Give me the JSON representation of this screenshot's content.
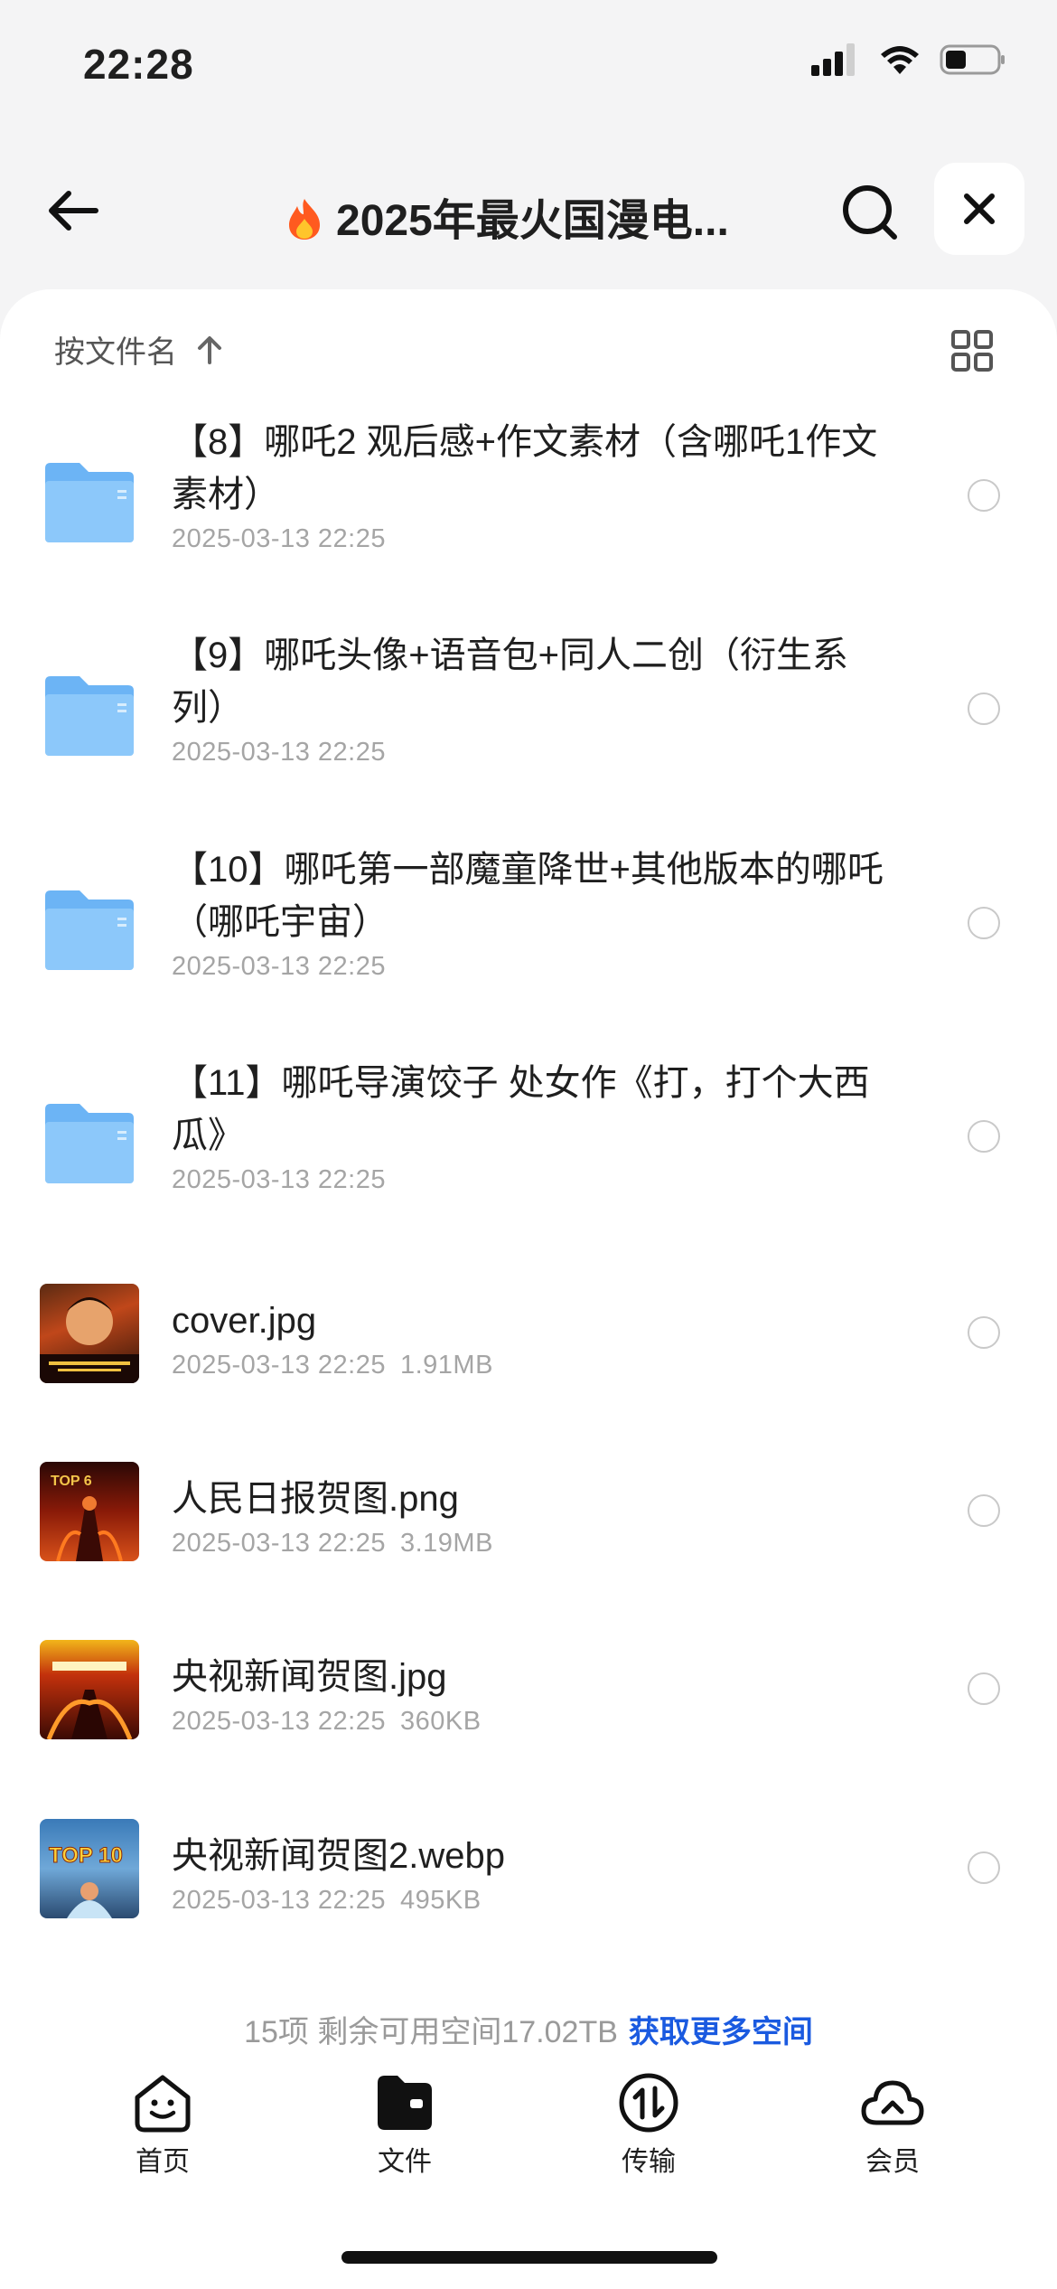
{
  "status_bar": {
    "time": "22:28"
  },
  "nav": {
    "title": "2025年最火国漫电...",
    "fire_icon": "fire-emoji"
  },
  "sort": {
    "label": "按文件名"
  },
  "files": [
    {
      "name": "【8】哪吒2 观后感+作文素材（含哪吒1作文素材）",
      "date": "2025-03-13 22:25",
      "size": "",
      "kind": "folder"
    },
    {
      "name": "【9】哪吒头像+语音包+同人二创（衍生系列）",
      "date": "2025-03-13 22:25",
      "size": "",
      "kind": "folder"
    },
    {
      "name": "【10】哪吒第一部魔童降世+其他版本的哪吒（哪吒宇宙）",
      "date": "2025-03-13 22:25",
      "size": "",
      "kind": "folder"
    },
    {
      "name": "【11】哪吒导演饺子 处女作《打，打个大西瓜》",
      "date": "2025-03-13 22:25",
      "size": "",
      "kind": "folder"
    },
    {
      "name": "cover.jpg",
      "date": "2025-03-13 22:25",
      "size": "1.91MB",
      "kind": "image"
    },
    {
      "name": "人民日报贺图.png",
      "date": "2025-03-13 22:25",
      "size": "3.19MB",
      "kind": "image"
    },
    {
      "name": "央视新闻贺图.jpg",
      "date": "2025-03-13 22:25",
      "size": "360KB",
      "kind": "image"
    },
    {
      "name": "央视新闻贺图2.webp",
      "date": "2025-03-13 22:25",
      "size": "495KB",
      "kind": "image"
    }
  ],
  "thumbs": {
    "cover_text": "",
    "thumb2_text": "TOP 6",
    "thumb4_text": "TOP 10"
  },
  "footer": {
    "summary": "15项 剩余可用空间17.02TB",
    "link": "获取更多空间"
  },
  "tabs": [
    {
      "label": "首页",
      "icon": "smile-face-icon"
    },
    {
      "label": "文件",
      "icon": "folder-icon"
    },
    {
      "label": "传输",
      "icon": "transfer-icon"
    },
    {
      "label": "会员",
      "icon": "cloud-icon"
    }
  ],
  "colors": {
    "accent": "#1a5ae0",
    "folder": "#6cb4f5",
    "background": "#f4f4f5"
  }
}
